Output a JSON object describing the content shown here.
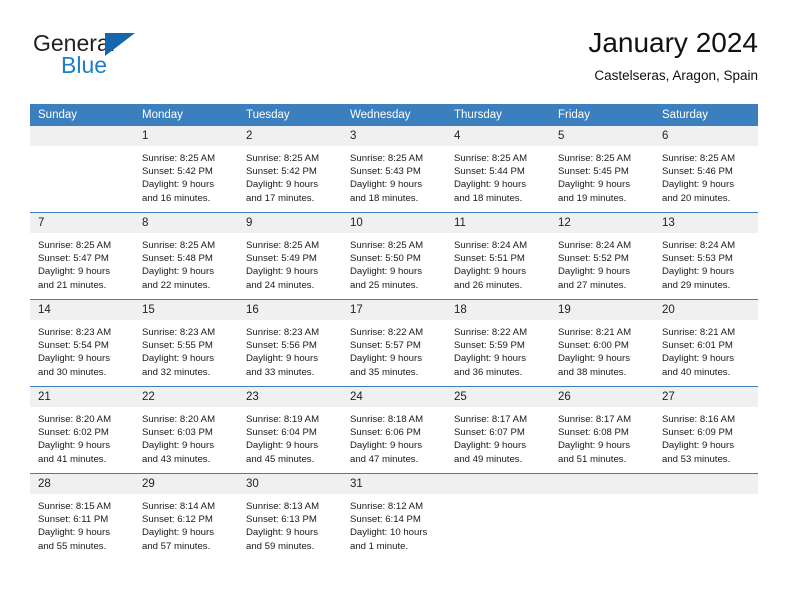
{
  "brand": {
    "name_part1": "General",
    "name_part2": "Blue",
    "triangle_color": "#1567ad",
    "blue_color": "#1f7fc4"
  },
  "header": {
    "title": "January 2024",
    "subtitle": "Castelseras, Aragon, Spain"
  },
  "theme": {
    "header_row_bg": "#3c7fbe",
    "daynum_bg": "#f0f0f0",
    "separator": "#3c7fbe",
    "text": "#1a1a1a"
  },
  "weekday_headers": [
    "Sunday",
    "Monday",
    "Tuesday",
    "Wednesday",
    "Thursday",
    "Friday",
    "Saturday"
  ],
  "weeks": [
    {
      "days": [
        {
          "num": "",
          "empty": true,
          "sunrise": "",
          "sunset": "",
          "daylight_l1": "",
          "daylight_l2": ""
        },
        {
          "num": "1",
          "empty": false,
          "sunrise": "Sunrise: 8:25 AM",
          "sunset": "Sunset: 5:42 PM",
          "daylight_l1": "Daylight: 9 hours",
          "daylight_l2": "and 16 minutes."
        },
        {
          "num": "2",
          "empty": false,
          "sunrise": "Sunrise: 8:25 AM",
          "sunset": "Sunset: 5:42 PM",
          "daylight_l1": "Daylight: 9 hours",
          "daylight_l2": "and 17 minutes."
        },
        {
          "num": "3",
          "empty": false,
          "sunrise": "Sunrise: 8:25 AM",
          "sunset": "Sunset: 5:43 PM",
          "daylight_l1": "Daylight: 9 hours",
          "daylight_l2": "and 18 minutes."
        },
        {
          "num": "4",
          "empty": false,
          "sunrise": "Sunrise: 8:25 AM",
          "sunset": "Sunset: 5:44 PM",
          "daylight_l1": "Daylight: 9 hours",
          "daylight_l2": "and 18 minutes."
        },
        {
          "num": "5",
          "empty": false,
          "sunrise": "Sunrise: 8:25 AM",
          "sunset": "Sunset: 5:45 PM",
          "daylight_l1": "Daylight: 9 hours",
          "daylight_l2": "and 19 minutes."
        },
        {
          "num": "6",
          "empty": false,
          "sunrise": "Sunrise: 8:25 AM",
          "sunset": "Sunset: 5:46 PM",
          "daylight_l1": "Daylight: 9 hours",
          "daylight_l2": "and 20 minutes."
        }
      ]
    },
    {
      "days": [
        {
          "num": "7",
          "empty": false,
          "sunrise": "Sunrise: 8:25 AM",
          "sunset": "Sunset: 5:47 PM",
          "daylight_l1": "Daylight: 9 hours",
          "daylight_l2": "and 21 minutes."
        },
        {
          "num": "8",
          "empty": false,
          "sunrise": "Sunrise: 8:25 AM",
          "sunset": "Sunset: 5:48 PM",
          "daylight_l1": "Daylight: 9 hours",
          "daylight_l2": "and 22 minutes."
        },
        {
          "num": "9",
          "empty": false,
          "sunrise": "Sunrise: 8:25 AM",
          "sunset": "Sunset: 5:49 PM",
          "daylight_l1": "Daylight: 9 hours",
          "daylight_l2": "and 24 minutes."
        },
        {
          "num": "10",
          "empty": false,
          "sunrise": "Sunrise: 8:25 AM",
          "sunset": "Sunset: 5:50 PM",
          "daylight_l1": "Daylight: 9 hours",
          "daylight_l2": "and 25 minutes."
        },
        {
          "num": "11",
          "empty": false,
          "sunrise": "Sunrise: 8:24 AM",
          "sunset": "Sunset: 5:51 PM",
          "daylight_l1": "Daylight: 9 hours",
          "daylight_l2": "and 26 minutes."
        },
        {
          "num": "12",
          "empty": false,
          "sunrise": "Sunrise: 8:24 AM",
          "sunset": "Sunset: 5:52 PM",
          "daylight_l1": "Daylight: 9 hours",
          "daylight_l2": "and 27 minutes."
        },
        {
          "num": "13",
          "empty": false,
          "sunrise": "Sunrise: 8:24 AM",
          "sunset": "Sunset: 5:53 PM",
          "daylight_l1": "Daylight: 9 hours",
          "daylight_l2": "and 29 minutes."
        }
      ]
    },
    {
      "days": [
        {
          "num": "14",
          "empty": false,
          "sunrise": "Sunrise: 8:23 AM",
          "sunset": "Sunset: 5:54 PM",
          "daylight_l1": "Daylight: 9 hours",
          "daylight_l2": "and 30 minutes."
        },
        {
          "num": "15",
          "empty": false,
          "sunrise": "Sunrise: 8:23 AM",
          "sunset": "Sunset: 5:55 PM",
          "daylight_l1": "Daylight: 9 hours",
          "daylight_l2": "and 32 minutes."
        },
        {
          "num": "16",
          "empty": false,
          "sunrise": "Sunrise: 8:23 AM",
          "sunset": "Sunset: 5:56 PM",
          "daylight_l1": "Daylight: 9 hours",
          "daylight_l2": "and 33 minutes."
        },
        {
          "num": "17",
          "empty": false,
          "sunrise": "Sunrise: 8:22 AM",
          "sunset": "Sunset: 5:57 PM",
          "daylight_l1": "Daylight: 9 hours",
          "daylight_l2": "and 35 minutes."
        },
        {
          "num": "18",
          "empty": false,
          "sunrise": "Sunrise: 8:22 AM",
          "sunset": "Sunset: 5:59 PM",
          "daylight_l1": "Daylight: 9 hours",
          "daylight_l2": "and 36 minutes."
        },
        {
          "num": "19",
          "empty": false,
          "sunrise": "Sunrise: 8:21 AM",
          "sunset": "Sunset: 6:00 PM",
          "daylight_l1": "Daylight: 9 hours",
          "daylight_l2": "and 38 minutes."
        },
        {
          "num": "20",
          "empty": false,
          "sunrise": "Sunrise: 8:21 AM",
          "sunset": "Sunset: 6:01 PM",
          "daylight_l1": "Daylight: 9 hours",
          "daylight_l2": "and 40 minutes."
        }
      ]
    },
    {
      "days": [
        {
          "num": "21",
          "empty": false,
          "sunrise": "Sunrise: 8:20 AM",
          "sunset": "Sunset: 6:02 PM",
          "daylight_l1": "Daylight: 9 hours",
          "daylight_l2": "and 41 minutes."
        },
        {
          "num": "22",
          "empty": false,
          "sunrise": "Sunrise: 8:20 AM",
          "sunset": "Sunset: 6:03 PM",
          "daylight_l1": "Daylight: 9 hours",
          "daylight_l2": "and 43 minutes."
        },
        {
          "num": "23",
          "empty": false,
          "sunrise": "Sunrise: 8:19 AM",
          "sunset": "Sunset: 6:04 PM",
          "daylight_l1": "Daylight: 9 hours",
          "daylight_l2": "and 45 minutes."
        },
        {
          "num": "24",
          "empty": false,
          "sunrise": "Sunrise: 8:18 AM",
          "sunset": "Sunset: 6:06 PM",
          "daylight_l1": "Daylight: 9 hours",
          "daylight_l2": "and 47 minutes."
        },
        {
          "num": "25",
          "empty": false,
          "sunrise": "Sunrise: 8:17 AM",
          "sunset": "Sunset: 6:07 PM",
          "daylight_l1": "Daylight: 9 hours",
          "daylight_l2": "and 49 minutes."
        },
        {
          "num": "26",
          "empty": false,
          "sunrise": "Sunrise: 8:17 AM",
          "sunset": "Sunset: 6:08 PM",
          "daylight_l1": "Daylight: 9 hours",
          "daylight_l2": "and 51 minutes."
        },
        {
          "num": "27",
          "empty": false,
          "sunrise": "Sunrise: 8:16 AM",
          "sunset": "Sunset: 6:09 PM",
          "daylight_l1": "Daylight: 9 hours",
          "daylight_l2": "and 53 minutes."
        }
      ]
    },
    {
      "days": [
        {
          "num": "28",
          "empty": false,
          "sunrise": "Sunrise: 8:15 AM",
          "sunset": "Sunset: 6:11 PM",
          "daylight_l1": "Daylight: 9 hours",
          "daylight_l2": "and 55 minutes."
        },
        {
          "num": "29",
          "empty": false,
          "sunrise": "Sunrise: 8:14 AM",
          "sunset": "Sunset: 6:12 PM",
          "daylight_l1": "Daylight: 9 hours",
          "daylight_l2": "and 57 minutes."
        },
        {
          "num": "30",
          "empty": false,
          "sunrise": "Sunrise: 8:13 AM",
          "sunset": "Sunset: 6:13 PM",
          "daylight_l1": "Daylight: 9 hours",
          "daylight_l2": "and 59 minutes."
        },
        {
          "num": "31",
          "empty": false,
          "sunrise": "Sunrise: 8:12 AM",
          "sunset": "Sunset: 6:14 PM",
          "daylight_l1": "Daylight: 10 hours",
          "daylight_l2": "and 1 minute."
        },
        {
          "num": "",
          "empty": true,
          "sunrise": "",
          "sunset": "",
          "daylight_l1": "",
          "daylight_l2": ""
        },
        {
          "num": "",
          "empty": true,
          "sunrise": "",
          "sunset": "",
          "daylight_l1": "",
          "daylight_l2": ""
        },
        {
          "num": "",
          "empty": true,
          "sunrise": "",
          "sunset": "",
          "daylight_l1": "",
          "daylight_l2": ""
        }
      ]
    }
  ]
}
